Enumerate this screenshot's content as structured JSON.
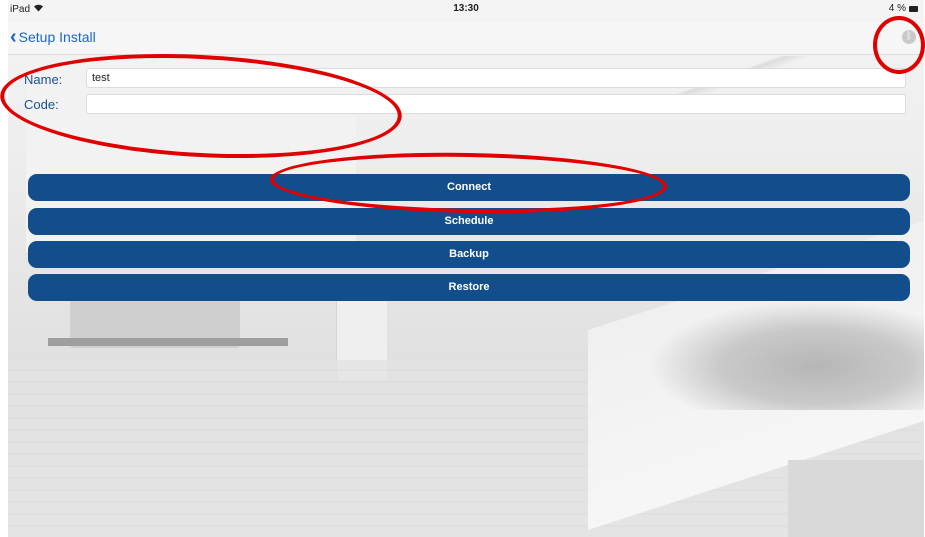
{
  "status_bar": {
    "device": "iPad",
    "time": "13:30",
    "battery_text": "4  %"
  },
  "nav": {
    "back_label": "Setup Install",
    "bluetooth_icon": "bluetooth-icon"
  },
  "form": {
    "name_label": "Name:",
    "name_value": "test",
    "code_label": "Code:",
    "code_value": ""
  },
  "buttons": [
    "Connect",
    "Schedule",
    "Backup",
    "Restore"
  ],
  "colors": {
    "accent": "#1a66c7",
    "button": "#124e8c",
    "annotation": "#e00000"
  }
}
